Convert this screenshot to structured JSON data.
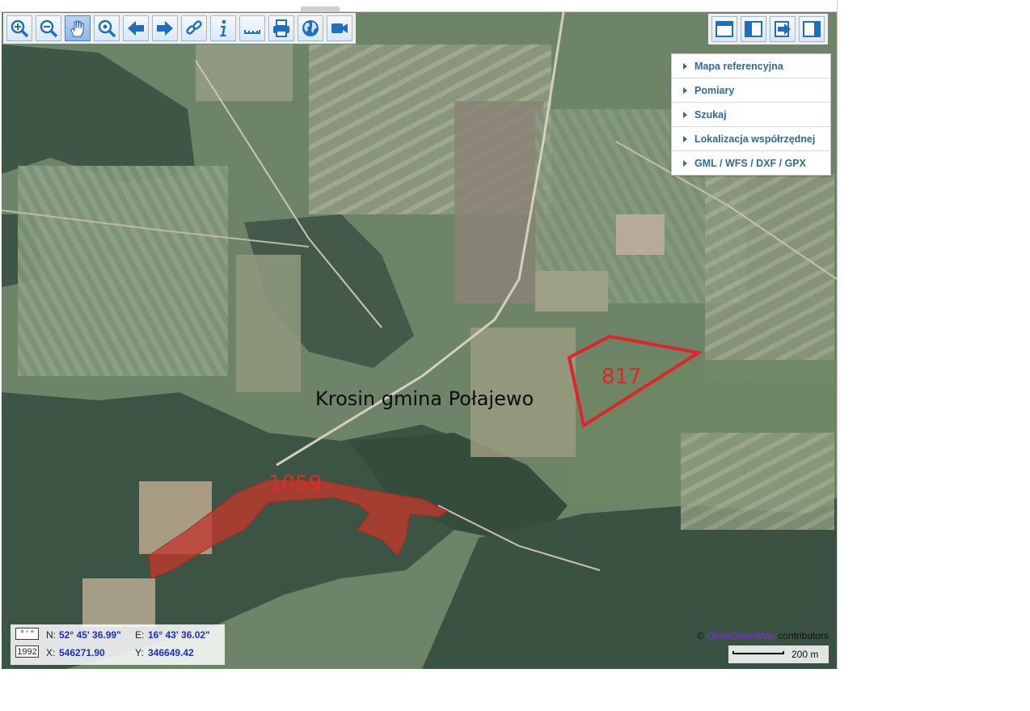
{
  "toolbar_left": [
    {
      "name": "zoom-in-icon",
      "label": "Zoom in"
    },
    {
      "name": "zoom-out-icon",
      "label": "Zoom out"
    },
    {
      "name": "hand-icon",
      "label": "Pan",
      "active": true
    },
    {
      "name": "zoom-extent-icon",
      "label": "Zoom"
    },
    {
      "name": "arrow-left-icon",
      "label": "Back"
    },
    {
      "name": "arrow-right-icon",
      "label": "Forward"
    },
    {
      "name": "link-icon",
      "label": "Link"
    },
    {
      "name": "info-icon",
      "label": "Info"
    },
    {
      "name": "ruler-icon",
      "label": "Measure"
    },
    {
      "name": "printer-icon",
      "label": "Print"
    },
    {
      "name": "globe-icon",
      "label": "Layers"
    },
    {
      "name": "video-camera-icon",
      "label": "Video"
    }
  ],
  "toolbar_right": [
    {
      "name": "layout-top-panel-icon"
    },
    {
      "name": "layout-left-panel-icon"
    },
    {
      "name": "export-arrow-icon"
    },
    {
      "name": "layout-right-panel-icon"
    }
  ],
  "side_menu": {
    "items": [
      {
        "label": "Mapa referencyjna"
      },
      {
        "label": "Pomiary"
      },
      {
        "label": "Szukaj"
      },
      {
        "label": "Lokalizacja współrzędnej"
      },
      {
        "label": "GML / WFS / DXF / GPX"
      }
    ]
  },
  "map": {
    "place_label": "Krosin gmina Połajewo",
    "parcels": [
      {
        "id": "817",
        "style": "outline"
      },
      {
        "id": "1059",
        "style": "filled"
      }
    ],
    "parcel_color": "#e0242b"
  },
  "coords": {
    "format_deg": "° ' \"",
    "format_1992": "1992",
    "n_label": "N:",
    "n_value": "52° 45' 36.99\"",
    "e_label": "E:",
    "e_value": "16° 43' 36.02\"",
    "x_label": "X:",
    "x_value": "546271.90",
    "y_label": "Y:",
    "y_value": "346649.42"
  },
  "attribution": {
    "copyright": "©",
    "source": "OpenStreetMap",
    "suffix": "contributors"
  },
  "scale": {
    "label": "200 m"
  }
}
